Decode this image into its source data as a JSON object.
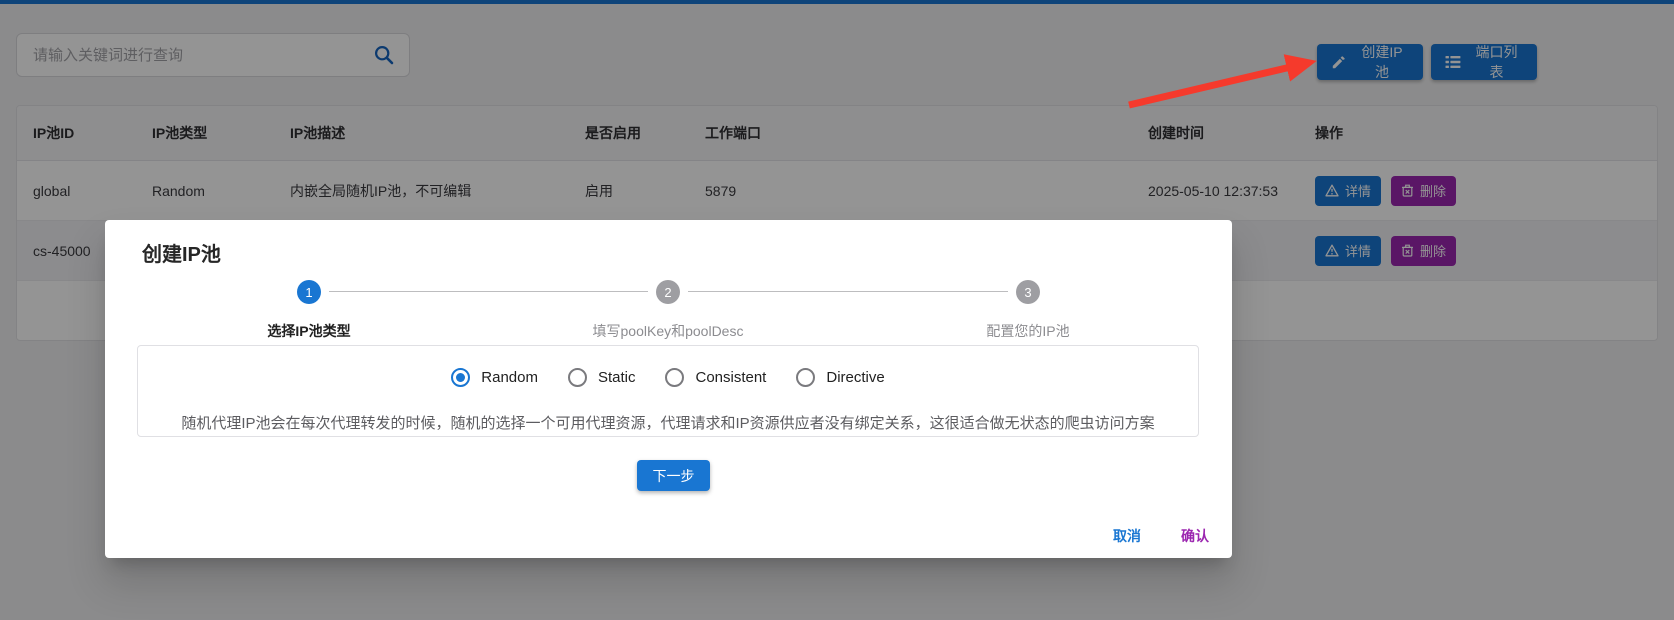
{
  "colors": {
    "primary": "#1976d2",
    "danger_purple": "#9c27b0",
    "arrow_red": "#f53a2c"
  },
  "icons": {
    "search": "search-icon (magnifier)",
    "create": "pencil-icon",
    "ports": "list-icon",
    "detail": "warning-triangle-icon",
    "delete": "trash-icon"
  },
  "search": {
    "placeholder": "请输入关键词进行查询"
  },
  "toolbar": {
    "create_button": "创建IP池",
    "ports_button": "端口列表"
  },
  "table": {
    "headers": [
      "IP池ID",
      "IP池类型",
      "IP池描述",
      "是否启用",
      "工作端口",
      "创建时间",
      "操作"
    ],
    "rows": [
      {
        "id": "global",
        "type": "Random",
        "desc": "内嵌全局随机IP池，不可编辑",
        "enabled": "启用",
        "port": "5879",
        "created": "2025-05-10 12:37:53",
        "detail_label": "详情",
        "delete_label": "删除"
      },
      {
        "id": "cs-45000",
        "detail_label": "详情",
        "delete_label": "删除"
      }
    ]
  },
  "modal": {
    "title": "创建IP池",
    "steps": [
      {
        "number": "1",
        "label": "选择IP池类型"
      },
      {
        "number": "2",
        "label": "填写poolKey和poolDesc"
      },
      {
        "number": "3",
        "label": "配置您的IP池"
      }
    ],
    "radio_options": [
      {
        "label": "Random",
        "selected": true
      },
      {
        "label": "Static",
        "selected": false
      },
      {
        "label": "Consistent",
        "selected": false
      },
      {
        "label": "Directive",
        "selected": false
      }
    ],
    "description": "随机代理IP池会在每次代理转发的时候，随机的选择一个可用代理资源，代理请求和IP资源供应者没有绑定关系，这很适合做无状态的爬虫访问方案",
    "next_button": "下一步",
    "cancel_label": "取消",
    "confirm_label": "确认"
  }
}
